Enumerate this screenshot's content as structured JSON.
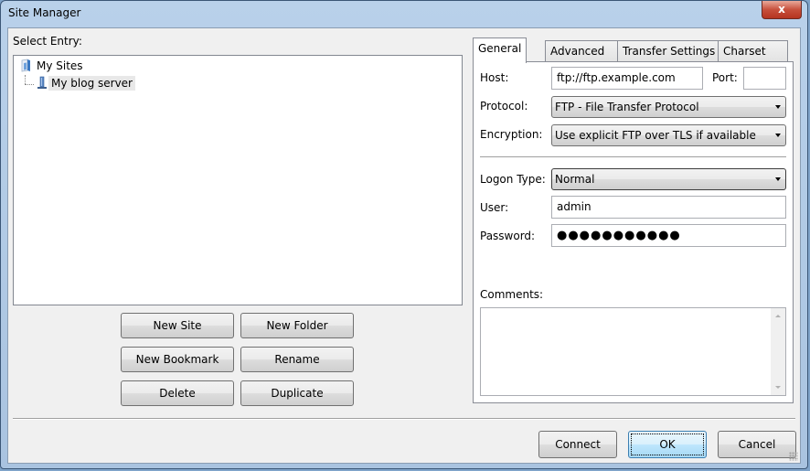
{
  "window": {
    "title": "Site Manager",
    "close_label": "x"
  },
  "left": {
    "select_entry_label": "Select Entry:",
    "tree": [
      {
        "label": "My Sites",
        "icon": "folder-icon",
        "level": 0
      },
      {
        "label": "My blog server",
        "icon": "server-icon",
        "level": 1,
        "selected": true
      }
    ],
    "buttons": {
      "new_site": "New Site",
      "new_folder": "New Folder",
      "new_bookmark": "New Bookmark",
      "rename": "Rename",
      "delete": "Delete",
      "duplicate": "Duplicate"
    }
  },
  "tabs": [
    {
      "label": "General",
      "active": true
    },
    {
      "label": "Advanced",
      "active": false
    },
    {
      "label": "Transfer Settings",
      "active": false
    },
    {
      "label": "Charset",
      "active": false
    }
  ],
  "general": {
    "host_label": "Host:",
    "host_value": "ftp://ftp.example.com",
    "port_label": "Port:",
    "port_value": "",
    "protocol_label": "Protocol:",
    "protocol_value": "FTP - File Transfer Protocol",
    "encryption_label": "Encryption:",
    "encryption_value": "Use explicit FTP over TLS if available",
    "logon_type_label": "Logon Type:",
    "logon_type_value": "Normal",
    "user_label": "User:",
    "user_value": "admin",
    "password_label": "Password:",
    "password_masked": "●●●●●●●●●●●",
    "comments_label": "Comments:",
    "comments_value": ""
  },
  "footer": {
    "connect": "Connect",
    "ok": "OK",
    "cancel": "Cancel"
  }
}
